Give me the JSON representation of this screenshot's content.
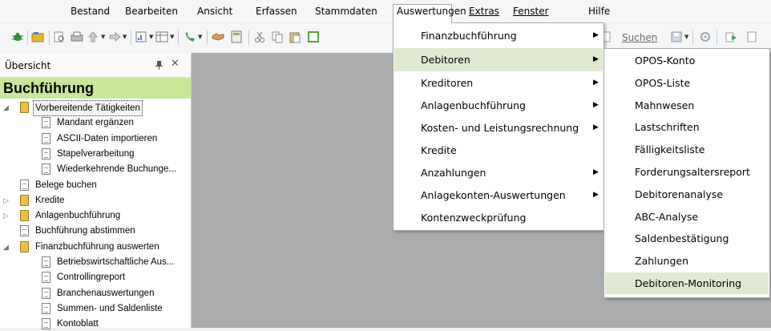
{
  "menubar": {
    "items": [
      "Bestand",
      "Bearbeiten",
      "Ansicht",
      "Erfassen",
      "Stammdaten",
      "Auswertungen",
      "Extras",
      "Fenster",
      "Hilfe"
    ],
    "open_item": "Auswertungen"
  },
  "toolbar": {
    "search_label": "Suchen"
  },
  "panel": {
    "title": "Übersicht",
    "section_title": "Buchführung",
    "tree": [
      {
        "label": "Vorbereitende Tätigkeiten",
        "icon": "folder-book-icon",
        "level": 0,
        "expanded": true,
        "selected": true
      },
      {
        "label": "Mandant ergänzen",
        "icon": "document-icon",
        "level": 1
      },
      {
        "label": "ASCII-Daten importieren",
        "icon": "document-icon",
        "level": 1
      },
      {
        "label": "Stapelverarbeitung",
        "icon": "document-icon",
        "level": 1
      },
      {
        "label": "Wiederkehrende Buchunge...",
        "icon": "document-icon",
        "level": 1
      },
      {
        "label": "Belege buchen",
        "icon": "document-icon",
        "level": 0
      },
      {
        "label": "Kredite",
        "icon": "folder-book-icon",
        "level": 0,
        "expanded": false
      },
      {
        "label": "Anlagenbuchführung",
        "icon": "folder-book-icon",
        "level": 0,
        "expanded": false
      },
      {
        "label": "Buchführung abstimmen",
        "icon": "document-icon",
        "level": 0
      },
      {
        "label": "Finanzbuchführung auswerten",
        "icon": "folder-book-icon",
        "level": 0,
        "expanded": true
      },
      {
        "label": "Betriebswirtschaftliche Aus...",
        "icon": "document-icon",
        "level": 1
      },
      {
        "label": "Controllingreport",
        "icon": "document-icon",
        "level": 1
      },
      {
        "label": "Branchenauswertungen",
        "icon": "document-icon",
        "level": 1
      },
      {
        "label": "Summen- und Saldenliste",
        "icon": "document-icon",
        "level": 1
      },
      {
        "label": "Kontoblatt",
        "icon": "document-icon",
        "level": 1
      }
    ]
  },
  "auswertungen_menu": {
    "items": [
      {
        "label": "Finanzbuchführung",
        "submenu": true
      },
      {
        "label": "Debitoren",
        "submenu": true,
        "highlighted": true
      },
      {
        "label": "Kreditoren",
        "submenu": true
      },
      {
        "label": "Anlagenbuchführung",
        "submenu": true
      },
      {
        "label": "Kosten- und Leistungsrechnung",
        "submenu": true
      },
      {
        "label": "Kredite",
        "submenu": false
      },
      {
        "label": "Anzahlungen",
        "submenu": true
      },
      {
        "label": "Anlagekonten-Auswertungen",
        "submenu": true
      },
      {
        "label": "Kontenzweckprüfung",
        "submenu": false
      }
    ]
  },
  "debitoren_submenu": {
    "items": [
      {
        "label": "OPOS-Konto"
      },
      {
        "label": "OPOS-Liste"
      },
      {
        "label": "Mahnwesen"
      },
      {
        "label": "Lastschriften"
      },
      {
        "label": "Fälligkeitsliste"
      },
      {
        "label": "Forderungsaltersreport"
      },
      {
        "label": "Debitorenanalyse"
      },
      {
        "label": "ABC-Analyse"
      },
      {
        "label": "Saldenbestätigung"
      },
      {
        "label": "Zahlungen"
      },
      {
        "label": "Debitoren-Monitoring",
        "highlighted": true
      }
    ]
  },
  "colors": {
    "section_banner": "#c9e79a",
    "menu_highlight": "#dfe9cf",
    "workspace": "#abacad"
  }
}
